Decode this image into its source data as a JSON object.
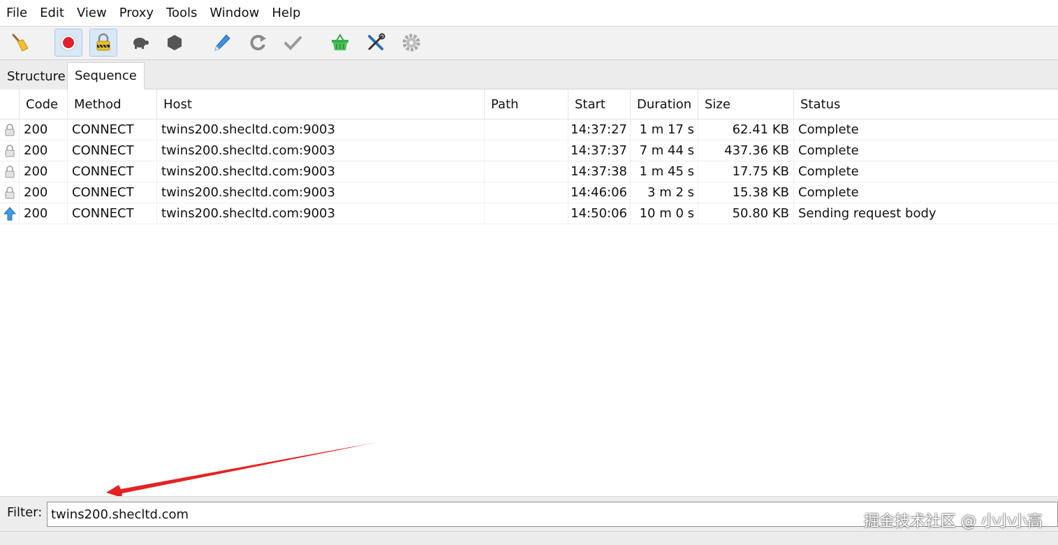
{
  "menu": [
    "File",
    "Edit",
    "View",
    "Proxy",
    "Tools",
    "Window",
    "Help"
  ],
  "toolbar": {
    "buttons": [
      "broom-icon",
      "record-icon",
      "ssl-proxy-icon",
      "throttle-turtle-icon",
      "breakpoint-hexagon-icon",
      "compose-pen-icon",
      "repeat-icon",
      "validate-check-icon",
      "basket-icon",
      "tools-icon",
      "settings-gear-icon"
    ]
  },
  "tabs": [
    "Structure",
    "Sequence"
  ],
  "table": {
    "columns": [
      "Code",
      "Method",
      "Host",
      "Path",
      "Start",
      "Duration",
      "Size",
      "Status"
    ],
    "rows": [
      {
        "icon": "lock-icon",
        "code": "200",
        "method": "CONNECT",
        "host": "twins200.shecltd.com:9003",
        "path": "",
        "start": "14:37:27",
        "duration": "1 m 17 s",
        "size": "62.41 KB",
        "status": "Complete"
      },
      {
        "icon": "lock-icon",
        "code": "200",
        "method": "CONNECT",
        "host": "twins200.shecltd.com:9003",
        "path": "",
        "start": "14:37:37",
        "duration": "7 m 44 s",
        "size": "437.36 KB",
        "status": "Complete"
      },
      {
        "icon": "lock-icon",
        "code": "200",
        "method": "CONNECT",
        "host": "twins200.shecltd.com:9003",
        "path": "",
        "start": "14:37:38",
        "duration": "1 m 45 s",
        "size": "17.75 KB",
        "status": "Complete"
      },
      {
        "icon": "lock-icon",
        "code": "200",
        "method": "CONNECT",
        "host": "twins200.shecltd.com:9003",
        "path": "",
        "start": "14:46:06",
        "duration": "3 m 2 s",
        "size": "15.38 KB",
        "status": "Complete"
      },
      {
        "icon": "upload-arrow-icon",
        "code": "200",
        "method": "CONNECT",
        "host": "twins200.shecltd.com:9003",
        "path": "",
        "start": "14:50:06",
        "duration": "10 m 0 s",
        "size": "50.80 KB",
        "status": "Sending request body"
      }
    ]
  },
  "filter": {
    "label": "Filter:",
    "value": "twins200.shecltd.com"
  },
  "watermark": "掘金技术社区 @ 小小小高",
  "colors": {
    "annotation_arrow": "#e52222",
    "active_button": "#d8e8f6"
  }
}
